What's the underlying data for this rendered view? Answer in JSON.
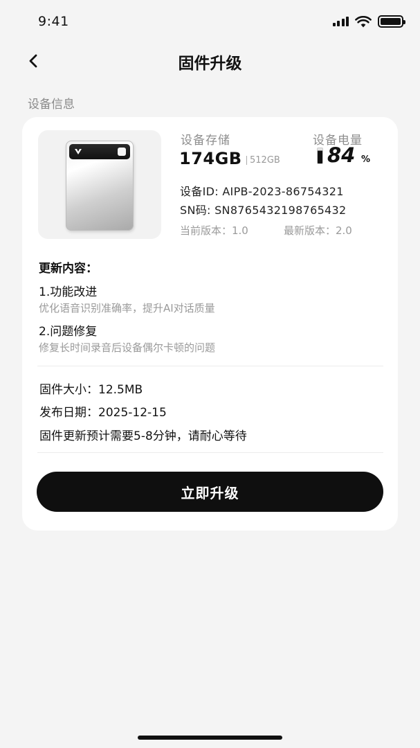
{
  "status_bar": {
    "time": "9:41"
  },
  "nav": {
    "title": "固件升级"
  },
  "section": {
    "device_info_label": "设备信息"
  },
  "device": {
    "storage_label": "设备存储",
    "storage_used": "174GB",
    "storage_total": "512GB",
    "power_label": "设备电量",
    "power_value": "84",
    "power_unit": "%",
    "power_level_percent": 84,
    "device_id": "设备ID: AIPB-2023-86754321",
    "serial": "SN码: SN8765432198765432",
    "current_version": "当前版本：1.0",
    "latest_version": "最新版本：2.0"
  },
  "updates": {
    "title": "更新内容：",
    "items": [
      {
        "title": "1.功能改进",
        "desc": "优化语音识别准确率，提升AI对话质量"
      },
      {
        "title": "2.问题修复",
        "desc": "修复长时间录音后设备偶尔卡顿的问题"
      }
    ]
  },
  "firmware": {
    "size": "固件大小：12.5MB",
    "release_date": "发布日期：2025-12-15",
    "duration_note": "固件更新预计需要5-8分钟，请耐心等待"
  },
  "actions": {
    "upgrade_label": "立即升级"
  },
  "colors": {
    "background": "#f4f4f4",
    "card": "#ffffff",
    "primary_button": "#0f0f0f",
    "secondary_text": "#9a9a9a"
  },
  "icons": {
    "back": "chevron-left-icon",
    "signal": "cellular-signal-icon",
    "wifi": "wifi-icon",
    "battery": "battery-icon"
  }
}
